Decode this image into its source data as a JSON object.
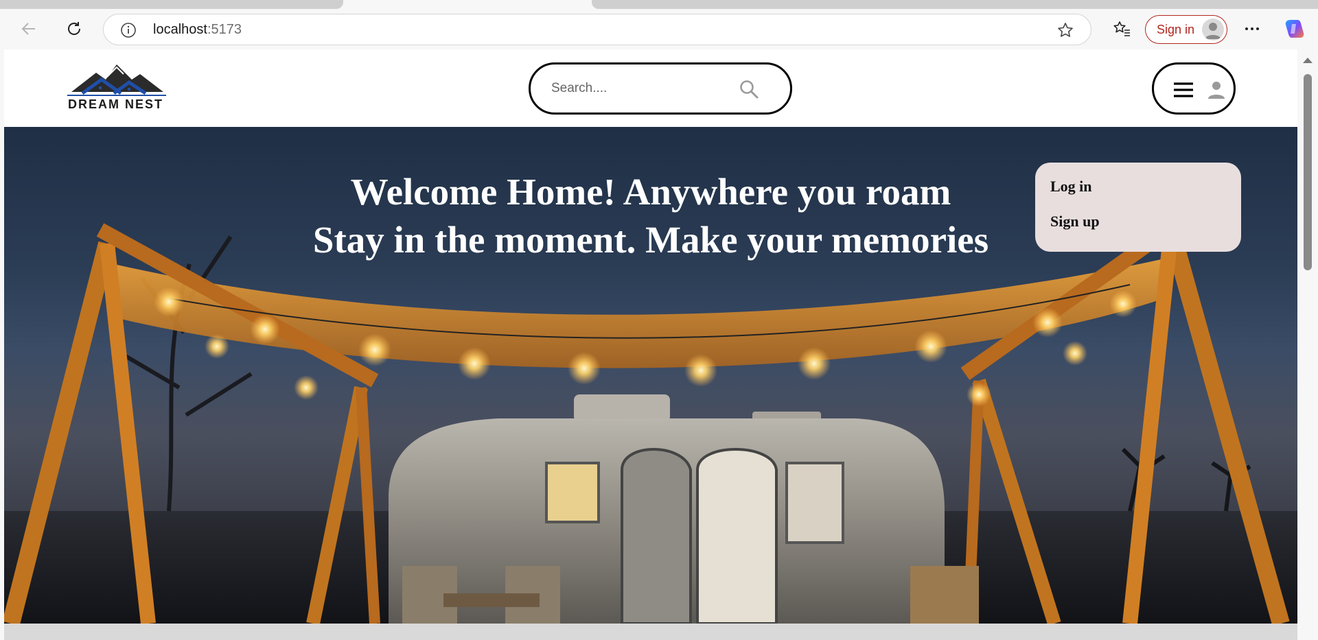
{
  "browser": {
    "url_host": "localhost",
    "url_port": ":5173",
    "signin_label": "Sign in"
  },
  "site": {
    "brand": "DREAM NEST",
    "search": {
      "placeholder": "Search...."
    },
    "hero": {
      "line1": "Welcome Home! Anywhere you roam",
      "line2": "Stay in the moment. Make your memories"
    },
    "user_menu": {
      "items": [
        {
          "label": "Log in"
        },
        {
          "label": "Sign up"
        }
      ]
    }
  },
  "colors": {
    "accent_red": "#b3261e",
    "dropdown_bg": "#e8dede",
    "logo_blue": "#1f4fa8"
  },
  "icons": [
    "back-arrow-icon",
    "refresh-icon",
    "info-icon",
    "star-icon",
    "favorites-icon",
    "more-icon",
    "copilot-icon",
    "search-icon",
    "hamburger-icon",
    "user-icon"
  ]
}
